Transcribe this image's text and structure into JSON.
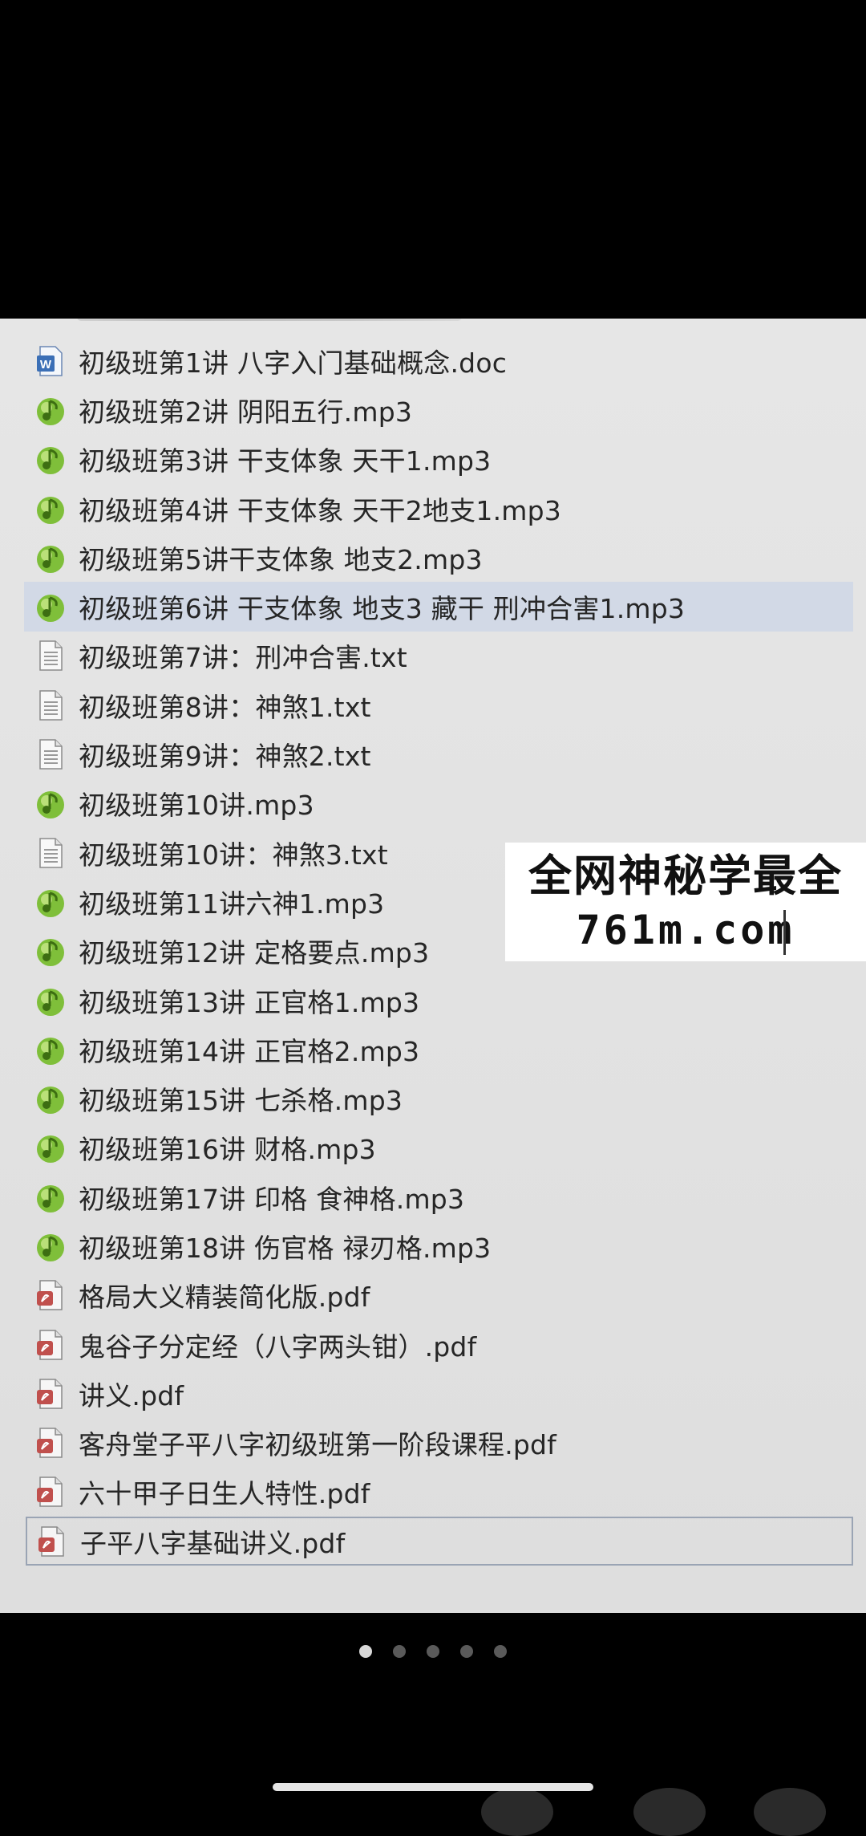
{
  "files": [
    {
      "name": "初级班第1讲 八字入门基础概念.doc",
      "type": "doc"
    },
    {
      "name": "初级班第2讲  阴阳五行.mp3",
      "type": "mp3"
    },
    {
      "name": "初级班第3讲 干支体象 天干1.mp3",
      "type": "mp3"
    },
    {
      "name": "初级班第4讲 干支体象 天干2地支1.mp3",
      "type": "mp3"
    },
    {
      "name": "初级班第5讲干支体象 地支2.mp3",
      "type": "mp3"
    },
    {
      "name": "初级班第6讲 干支体象 地支3 藏干 刑冲合害1.mp3",
      "type": "mp3",
      "state": "selected"
    },
    {
      "name": "初级班第7讲：刑冲合害.txt",
      "type": "txt"
    },
    {
      "name": "初级班第8讲：神煞1.txt",
      "type": "txt"
    },
    {
      "name": "初级班第9讲：神煞2.txt",
      "type": "txt"
    },
    {
      "name": "初级班第10讲.mp3",
      "type": "mp3"
    },
    {
      "name": "初级班第10讲：神煞3.txt",
      "type": "txt"
    },
    {
      "name": "初级班第11讲六神1.mp3",
      "type": "mp3"
    },
    {
      "name": "初级班第12讲 定格要点.mp3",
      "type": "mp3"
    },
    {
      "name": "初级班第13讲 正官格1.mp3",
      "type": "mp3"
    },
    {
      "name": "初级班第14讲 正官格2.mp3",
      "type": "mp3"
    },
    {
      "name": "初级班第15讲 七杀格.mp3",
      "type": "mp3"
    },
    {
      "name": "初级班第16讲 财格.mp3",
      "type": "mp3"
    },
    {
      "name": "初级班第17讲 印格 食神格.mp3",
      "type": "mp3"
    },
    {
      "name": "初级班第18讲 伤官格 禄刃格.mp3",
      "type": "mp3"
    },
    {
      "name": "格局大义精装简化版.pdf",
      "type": "pdf"
    },
    {
      "name": "鬼谷子分定经（八字两头钳）.pdf",
      "type": "pdf"
    },
    {
      "name": "讲义.pdf",
      "type": "pdf"
    },
    {
      "name": "客舟堂子平八字初级班第一阶段课程.pdf",
      "type": "pdf"
    },
    {
      "name": "六十甲子日生人特性.pdf",
      "type": "pdf"
    },
    {
      "name": "子平八字基础讲义.pdf",
      "type": "pdf",
      "state": "focused"
    }
  ],
  "icons": {
    "doc": "word-document-icon",
    "mp3": "audio-file-icon",
    "txt": "text-file-icon",
    "pdf": "pdf-file-icon"
  },
  "watermark": {
    "line1": "全网神秘学最全",
    "line2": "761m.com"
  },
  "pager": {
    "count": 5,
    "active_index": 0
  },
  "colors": {
    "mp3_icon": "#8cc63f",
    "pdf_icon": "#c0504d",
    "doc_icon": "#3b6fb6",
    "selection": "#c3d0e8"
  }
}
